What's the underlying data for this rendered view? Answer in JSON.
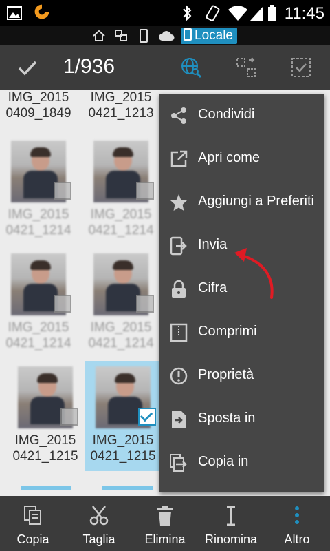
{
  "status_bar": {
    "time": "11:45",
    "icons": [
      "picture-icon",
      "app-logo-icon",
      "bluetooth-icon",
      "vibrate-icon",
      "wifi-icon",
      "signal-icon",
      "battery-icon"
    ]
  },
  "location_bar": {
    "icons": [
      "home-icon",
      "network-icon",
      "phone-icon",
      "cloud-icon"
    ],
    "locale_label": "Locale"
  },
  "toolbar": {
    "selection_count": "1/936",
    "icons": [
      "check-icon",
      "globe-search-icon",
      "select-range-icon",
      "select-all-icon"
    ]
  },
  "files": [
    {
      "line1": "IMG_2015",
      "line2": "0409_1849",
      "selected": false
    },
    {
      "line1": "IMG_2015",
      "line2": "0421_1213",
      "selected": false
    },
    {
      "line1": "IMG_2015",
      "line2": "0421_1214",
      "selected": false
    },
    {
      "line1": "IMG_2015",
      "line2": "0421_1214",
      "selected": false
    },
    {
      "line1": "IMG_2015",
      "line2": "0421_1214",
      "selected": false
    },
    {
      "line1": "IMG_2015",
      "line2": "0421_1214",
      "selected": false
    },
    {
      "line1": "IMG_2015",
      "line2": "0421_1215",
      "selected": false
    },
    {
      "line1": "IMG_2015",
      "line2": "0421_1215",
      "selected": true
    }
  ],
  "menu": {
    "items": [
      {
        "label": "Condividi",
        "icon": "share-icon"
      },
      {
        "label": "Apri come",
        "icon": "open-external-icon"
      },
      {
        "label": "Aggiungi a Preferiti",
        "icon": "star-icon"
      },
      {
        "label": "Invia",
        "icon": "send-device-icon"
      },
      {
        "label": "Cifra",
        "icon": "lock-icon"
      },
      {
        "label": "Comprimi",
        "icon": "zip-icon"
      },
      {
        "label": "Proprietà",
        "icon": "info-icon"
      },
      {
        "label": "Sposta in",
        "icon": "move-icon"
      },
      {
        "label": "Copia in",
        "icon": "copy-to-icon"
      }
    ]
  },
  "bottom_bar": {
    "items": [
      {
        "label": "Copia",
        "icon": "copy-icon"
      },
      {
        "label": "Taglia",
        "icon": "scissors-icon"
      },
      {
        "label": "Elimina",
        "icon": "trash-icon"
      },
      {
        "label": "Rinomina",
        "icon": "rename-icon"
      },
      {
        "label": "Altro",
        "icon": "more-vertical-icon"
      }
    ]
  },
  "colors": {
    "accent": "#1f8fbf",
    "toolbar": "#3b3b3b",
    "menu": "#464646",
    "selection": "#a7d8ef",
    "annotation_arrow": "#e01b24"
  }
}
